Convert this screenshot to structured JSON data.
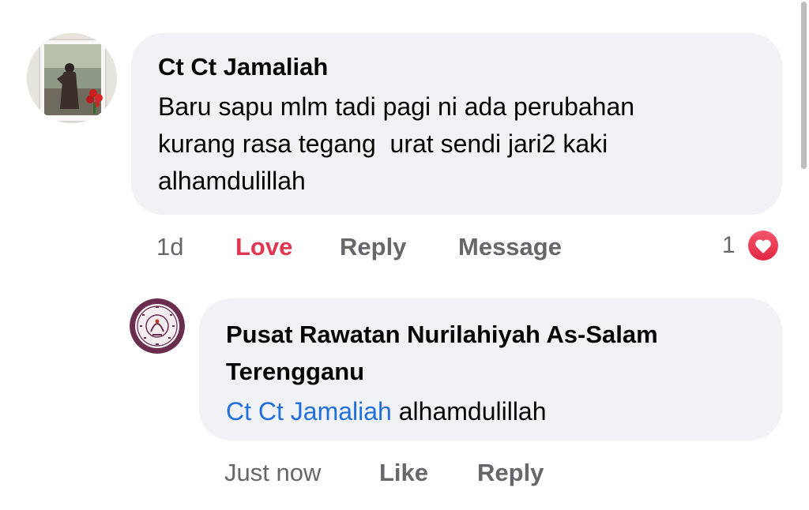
{
  "comment": {
    "author": "Ct Ct Jamaliah",
    "text": "Baru sapu mlm tadi pagi ni ada perubahan\nkurang rasa tegang  urat sendi jari2 kaki\nalhamdulillah",
    "time": "1d",
    "love_label": "Love",
    "reply_label": "Reply",
    "message_label": "Message",
    "reaction_count": "1",
    "reaction_type": "heart-icon",
    "love_color": "#e0364f"
  },
  "reply": {
    "author": "Pusat Rawatan Nurilahiyah As-Salam Terengganu",
    "mention": "Ct Ct Jamaliah",
    "text": " alhamdulillah",
    "time": "Just now",
    "like_label": "Like",
    "reply_label": "Reply",
    "mention_color": "#216fdb"
  }
}
